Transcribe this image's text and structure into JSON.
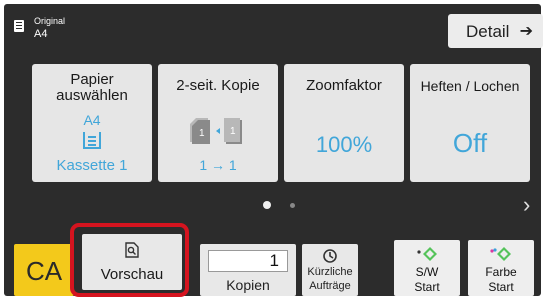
{
  "original": {
    "label": "Original",
    "value": "A4"
  },
  "detail": {
    "label": "Detail",
    "arrow": "➔"
  },
  "cards": {
    "paper": {
      "title_line1": "Papier",
      "title_line2": "auswählen",
      "size": "A4",
      "tray": "Kassette 1"
    },
    "duplex": {
      "title": "2-seit. Kopie",
      "mode": "1 → 1"
    },
    "zoom": {
      "title": "Zoomfaktor",
      "value": "100%"
    },
    "staple": {
      "title": "Heften / Lochen",
      "value": "Off"
    }
  },
  "pager": {
    "next": "›"
  },
  "bottom": {
    "clear_all": "CA",
    "preview": "Vorschau",
    "copies_value": "1",
    "copies_label": "Kopien",
    "recent_line1": "Kürzliche",
    "recent_line2": "Aufträge",
    "bw_start_line1": "S/W",
    "bw_start_line2": "Start",
    "color_start_line1": "Farbe",
    "color_start_line2": "Start"
  },
  "colors": {
    "accent_blue": "#41a6d9",
    "ca_yellow": "#f3c91b",
    "highlight_red": "#d5141f",
    "start_green": "#55c35a"
  },
  "icons": {
    "original": "document-icon",
    "tray": "paper-tray-icon",
    "duplex": "duplex-pages-icon",
    "preview": "preview-magnifier-icon",
    "recent": "recent-jobs-icon",
    "start": "start-diamond-icon"
  }
}
